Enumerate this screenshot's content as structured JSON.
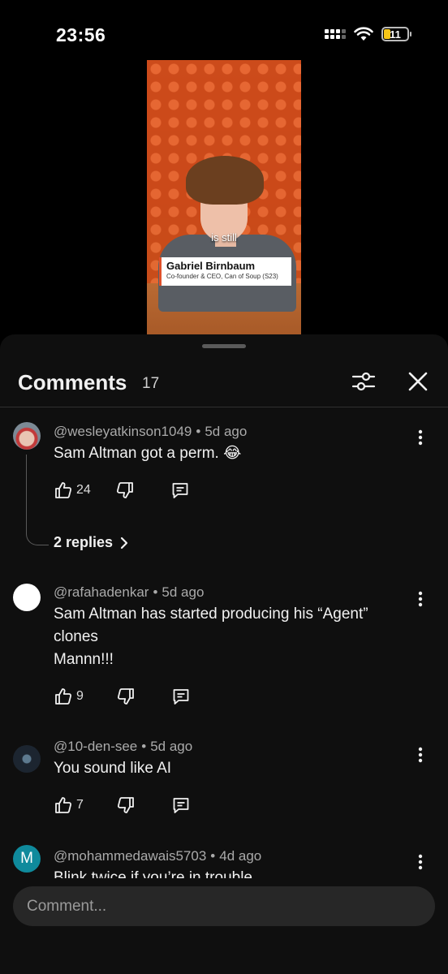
{
  "status_bar": {
    "time": "23:56",
    "battery": "11"
  },
  "video": {
    "caption": "is still",
    "name": "Gabriel Birnbaum",
    "role": "Co-founder & CEO, Can of Soup (S23)"
  },
  "sheet": {
    "title": "Comments",
    "count": "17"
  },
  "comments": [
    {
      "handle": "@wesleyatkinson1049",
      "time": "5d ago",
      "text": "Sam Altman got a perm. 😂",
      "likes": "24",
      "replies": "2 replies"
    },
    {
      "handle": "@rafahadenkar",
      "time": "5d ago",
      "text_lines": [
        "Sam Altman has started producing his “Agent”",
        "clones",
        "Mannn!!!"
      ],
      "likes": "9"
    },
    {
      "handle": "@10-den-see",
      "time": "5d ago",
      "text": "You sound like AI",
      "likes": "7"
    },
    {
      "handle": "@mohammedawais5703",
      "time": "4d ago",
      "text": "Blink twice if you’re in trouble",
      "avatar_letter": "M"
    }
  ],
  "composer": {
    "placeholder": "Comment..."
  },
  "colors": {
    "accent_avatar": "#0f8a9c",
    "sheet_bg": "#0f0f0f",
    "composer_bg": "#272727"
  }
}
